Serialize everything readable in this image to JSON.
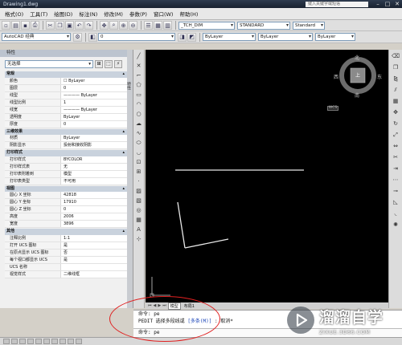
{
  "window": {
    "title": "Drawing1.dwg",
    "search_placeholder": "键入关键字或短语"
  },
  "menu": [
    "格式(O)",
    "工具(T)",
    "绘图(D)",
    "标注(N)",
    "修改(M)",
    "参数(P)",
    "窗口(W)",
    "帮助(H)"
  ],
  "toolbar": {
    "workspace": "AutoCAD 经典",
    "layer_value": "0",
    "dim_style": "_TCH_DIM",
    "text_style": "STANDARD",
    "extra_style": "Standard",
    "color_value": "ByLayer",
    "linetype_value": "ByLayer",
    "lineweight_value": "ByLayer"
  },
  "properties": {
    "header": "特性",
    "close": "✕",
    "selection": "无选择",
    "side_label": "特性",
    "sections": [
      {
        "title": "常规",
        "rows": [
          {
            "k": "颜色",
            "v": "☐ ByLayer"
          },
          {
            "k": "图层",
            "v": "0"
          },
          {
            "k": "线型",
            "v": "———— ByLayer"
          },
          {
            "k": "线型比例",
            "v": "1"
          },
          {
            "k": "线宽",
            "v": "———— ByLayer"
          },
          {
            "k": "透明度",
            "v": "ByLayer"
          },
          {
            "k": "厚度",
            "v": "0"
          }
        ]
      },
      {
        "title": "三维效果",
        "rows": [
          {
            "k": "材质",
            "v": "ByLayer"
          },
          {
            "k": "阴影显示",
            "v": "投射和接收阴影"
          }
        ]
      },
      {
        "title": "打印样式",
        "rows": [
          {
            "k": "打印样式",
            "v": "BYCOLOR"
          },
          {
            "k": "打印样式表",
            "v": "无"
          },
          {
            "k": "打印表附着到",
            "v": "模型"
          },
          {
            "k": "打印表类型",
            "v": "不可用"
          }
        ]
      },
      {
        "title": "视图",
        "rows": [
          {
            "k": "圆心 X 坐标",
            "v": "42818"
          },
          {
            "k": "圆心 Y 坐标",
            "v": "17910"
          },
          {
            "k": "圆心 Z 坐标",
            "v": "0"
          },
          {
            "k": "高度",
            "v": "2006"
          },
          {
            "k": "宽度",
            "v": "3896"
          }
        ]
      },
      {
        "title": "其他",
        "rows": [
          {
            "k": "注释比例",
            "v": "1:1"
          },
          {
            "k": "打开 UCS 图标",
            "v": "是"
          },
          {
            "k": "在原点显示 UCS 图标",
            "v": "否"
          },
          {
            "k": "每个视口都显示 UCS",
            "v": "是"
          },
          {
            "k": "UCS 名称",
            "v": ""
          },
          {
            "k": "视觉样式",
            "v": "二维线框"
          }
        ]
      }
    ]
  },
  "viewcube": {
    "north": "北",
    "south": "南",
    "east": "东",
    "west": "西",
    "top": "上",
    "wcs": "WCS"
  },
  "tabs": {
    "model": "模型",
    "layout1": "布局1"
  },
  "command": {
    "history1": "命令: pe",
    "history2_prefix": "PEDIT 选择多段线或",
    "history2_option": "[多条(M)]",
    "history2_suffix": ": 取消*",
    "input": "命令: pe"
  },
  "watermark": {
    "brand": "溜溜自学",
    "url": "ZIXUE.3D66.COM"
  }
}
